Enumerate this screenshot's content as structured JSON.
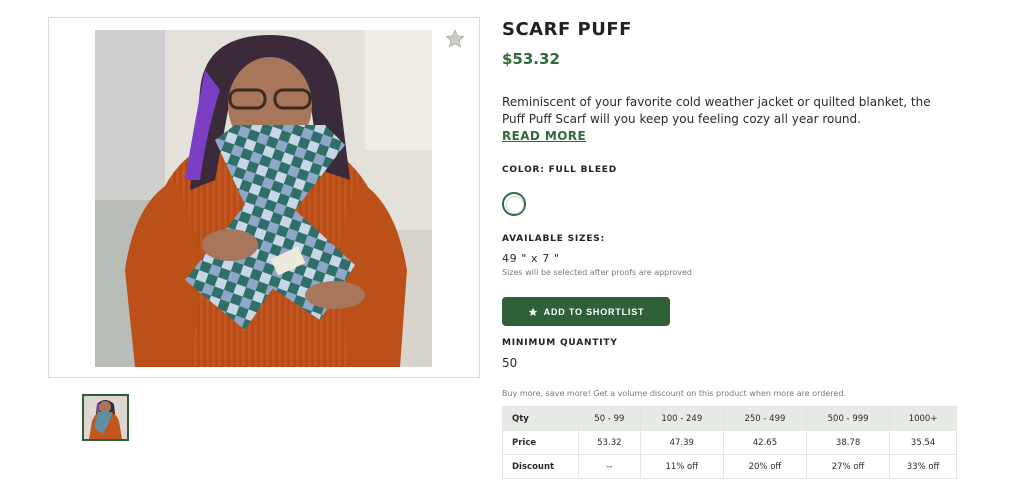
{
  "product": {
    "title": "SCARF PUFF",
    "price": "$53.32",
    "description": "Reminiscent of your favorite cold weather jacket or quilted blanket, the Puff Puff Scarf will you keep you feeling cozy all year round.",
    "read_more": "READ MORE"
  },
  "color": {
    "label": "COLOR: FULL BLEED"
  },
  "sizes": {
    "label": "AVAILABLE SIZES:",
    "value": "49 \" x 7 \"",
    "note": "Sizes will be selected after proofs are approved"
  },
  "actions": {
    "add_to_shortlist": "ADD TO SHORTLIST"
  },
  "minimum": {
    "label": "MINIMUM QUANTITY",
    "value": "50"
  },
  "volume": {
    "note": "Buy more, save more! Get a volume discount on this product when more are ordered."
  },
  "pricing_table": {
    "header": [
      "Qty",
      "50 - 99",
      "100 - 249",
      "250 - 499",
      "500 - 999",
      "1000+"
    ],
    "rows": [
      [
        "Price",
        "53.32",
        "47.39",
        "42.65",
        "38.78",
        "35.54"
      ],
      [
        "Discount",
        "--",
        "11% off",
        "20% off",
        "27% off",
        "33% off"
      ]
    ]
  },
  "colors": {
    "brand_green": "#2f6138",
    "price_green": "#2f6b3c",
    "table_header_bg": "#e6ebe6"
  },
  "icons": {
    "favorite": "star-icon",
    "button": "star-icon"
  }
}
